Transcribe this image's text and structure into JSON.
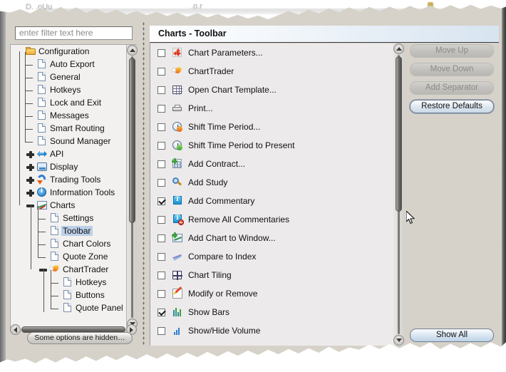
{
  "window": {
    "torn_edges": true
  },
  "ghost_text": {
    "left": "D.  .oUu",
    "right": ".o.r"
  },
  "sidebar": {
    "filter": {
      "value": "",
      "placeholder": "enter filter text here"
    },
    "items": [
      {
        "label": "Configuration",
        "icon": "folder-icon",
        "depth": 0,
        "toggle": "none",
        "selected": false
      },
      {
        "label": "Auto Export",
        "icon": "document-icon",
        "depth": 1,
        "toggle": "none",
        "selected": false
      },
      {
        "label": "General",
        "icon": "document-icon",
        "depth": 1,
        "toggle": "none",
        "selected": false
      },
      {
        "label": "Hotkeys",
        "icon": "document-icon",
        "depth": 1,
        "toggle": "none",
        "selected": false
      },
      {
        "label": "Lock and Exit",
        "icon": "document-icon",
        "depth": 1,
        "toggle": "none",
        "selected": false
      },
      {
        "label": "Messages",
        "icon": "document-icon",
        "depth": 1,
        "toggle": "none",
        "selected": false
      },
      {
        "label": "Smart Routing",
        "icon": "document-icon",
        "depth": 1,
        "toggle": "none",
        "selected": false
      },
      {
        "label": "Sound Manager",
        "icon": "document-icon",
        "depth": 1,
        "toggle": "none",
        "selected": false
      },
      {
        "label": "API",
        "icon": "api-icon",
        "depth": 1,
        "toggle": "plus",
        "selected": false
      },
      {
        "label": "Display",
        "icon": "display-icon",
        "depth": 1,
        "toggle": "plus",
        "selected": false
      },
      {
        "label": "Trading Tools",
        "icon": "trading-tools-icon",
        "depth": 1,
        "toggle": "plus",
        "selected": false
      },
      {
        "label": "Information Tools",
        "icon": "info-icon",
        "depth": 1,
        "toggle": "plus",
        "selected": false
      },
      {
        "label": "Charts",
        "icon": "charts-icon",
        "depth": 1,
        "toggle": "minus",
        "selected": false
      },
      {
        "label": "Settings",
        "icon": "document-icon",
        "depth": 2,
        "toggle": "none",
        "selected": false
      },
      {
        "label": "Toolbar",
        "icon": "document-icon",
        "depth": 2,
        "toggle": "none",
        "selected": true
      },
      {
        "label": "Chart Colors",
        "icon": "document-icon",
        "depth": 2,
        "toggle": "none",
        "selected": false
      },
      {
        "label": "Quote Zone",
        "icon": "document-icon",
        "depth": 2,
        "toggle": "none",
        "selected": false
      },
      {
        "label": "ChartTrader",
        "icon": "charttrader-icon",
        "depth": 2,
        "toggle": "minus",
        "selected": false
      },
      {
        "label": "Hotkeys",
        "icon": "document-icon",
        "depth": 3,
        "toggle": "none",
        "selected": false
      },
      {
        "label": "Buttons",
        "icon": "document-icon",
        "depth": 3,
        "toggle": "none",
        "selected": false
      },
      {
        "label": "Quote Panel",
        "icon": "document-icon",
        "depth": 3,
        "toggle": "none",
        "selected": false
      }
    ],
    "hidden_options_button": "Some options are hidden…"
  },
  "content": {
    "title": "Charts - Toolbar",
    "options": [
      {
        "label": "Chart Parameters...",
        "checked": false,
        "icon": "chart-parameters-icon"
      },
      {
        "label": "ChartTrader",
        "checked": false,
        "icon": "charttrader-icon"
      },
      {
        "label": "Open Chart Template...",
        "checked": false,
        "icon": "chart-template-icon"
      },
      {
        "label": "Print...",
        "checked": false,
        "icon": "printer-icon"
      },
      {
        "label": "Shift Time Period...",
        "checked": false,
        "icon": "shift-time-period-icon"
      },
      {
        "label": "Shift Time Period to Present",
        "checked": false,
        "icon": "shift-time-present-icon"
      },
      {
        "label": "Add Contract...",
        "checked": false,
        "icon": "add-contract-icon"
      },
      {
        "label": "Add Study",
        "checked": false,
        "icon": "magnifier-icon"
      },
      {
        "label": "Add Commentary",
        "checked": true,
        "icon": "add-commentary-icon"
      },
      {
        "label": "Remove All Commentaries",
        "checked": false,
        "icon": "remove-commentaries-icon"
      },
      {
        "label": "Add Chart to Window...",
        "checked": false,
        "icon": "add-chart-to-window-icon"
      },
      {
        "label": "Compare to Index",
        "checked": false,
        "icon": "compare-index-icon"
      },
      {
        "label": "Chart Tiling",
        "checked": false,
        "icon": "chart-tiling-icon"
      },
      {
        "label": "Modify or Remove",
        "checked": false,
        "icon": "pencil-icon"
      },
      {
        "label": "Show Bars",
        "checked": true,
        "icon": "show-bars-icon"
      },
      {
        "label": "Show/Hide Volume",
        "checked": false,
        "icon": "volume-icon"
      }
    ]
  },
  "actions": {
    "move_up": "Move Up",
    "move_down": "Move Down",
    "add_separator": "Add Separator",
    "restore_defaults": "Restore Defaults",
    "show_all": "Show All"
  },
  "colors": {
    "dialog_bg": "#d6d2ca",
    "list_bg": "#eceaea",
    "title_gradient_end": "#d7e4f0",
    "selection": "#bdd0e8",
    "accent_blue": "#2f7fd0"
  }
}
